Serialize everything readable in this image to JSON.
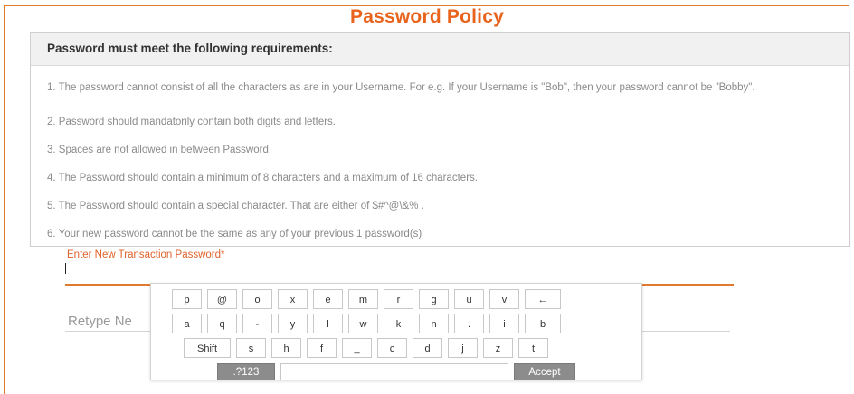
{
  "page": {
    "title": "Password Policy"
  },
  "policy": {
    "heading": "Password must meet the following requirements:",
    "rules": [
      "1. The password cannot consist of all the characters as are in your Username. For e.g. If your Username is \"Bob\", then your password cannot be \"Bobby\".",
      "2. Password should mandatorily contain both digits and letters.",
      "3. Spaces are not allowed in between Password.",
      "4. The Password should contain a minimum of 8 characters and a maximum of 16 characters.",
      "5. The Password should contain a special character. That are either of $#^@\\&% .",
      "6. Your new password cannot be the same as any of your previous 1 password(s)"
    ]
  },
  "form": {
    "new_password_label": "Enter New Transaction Password",
    "required_mark": "*",
    "new_password_value": "",
    "retype_label": "Retype Ne"
  },
  "keyboard": {
    "row1": [
      "p",
      "@",
      "o",
      "x",
      "e",
      "m",
      "r",
      "g",
      "u",
      "v",
      "←"
    ],
    "row2": [
      "a",
      "q",
      "-",
      "y",
      "l",
      "w",
      "k",
      "n",
      ".",
      "i",
      "b"
    ],
    "row3": [
      "Shift",
      "s",
      "h",
      "f",
      "_",
      "c",
      "d",
      "j",
      "z",
      "t"
    ],
    "mode_key": ".?123",
    "accept_key": "Accept"
  },
  "colors": {
    "accent": "#e8641e",
    "border": "#e07a2e",
    "key_dark": "#8c8c8c"
  }
}
